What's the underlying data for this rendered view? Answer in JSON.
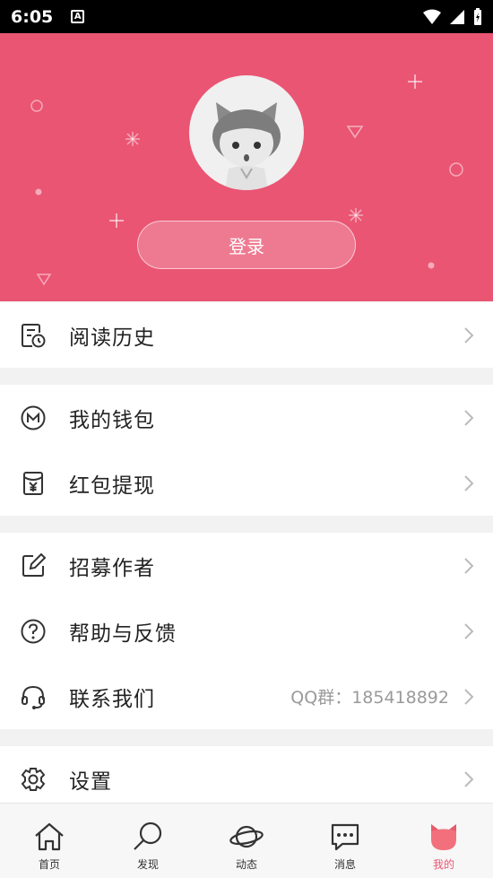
{
  "status_bar": {
    "time": "6:05",
    "badge": "A"
  },
  "header": {
    "login_label": "登录"
  },
  "menu": {
    "reading_history": "阅读历史",
    "my_wallet": "我的钱包",
    "red_packet_withdraw": "红包提现",
    "recruit_authors": "招募作者",
    "help_feedback": "帮助与反馈",
    "contact_us": "联系我们",
    "contact_us_value": "QQ群：185418892",
    "settings": "设置"
  },
  "tabs": [
    {
      "label": "首页",
      "icon": "home-icon"
    },
    {
      "label": "发现",
      "icon": "search-icon"
    },
    {
      "label": "动态",
      "icon": "planet-icon"
    },
    {
      "label": "消息",
      "icon": "message-icon"
    },
    {
      "label": "我的",
      "icon": "cat-icon",
      "active": true
    }
  ],
  "colors": {
    "accent": "#ea5573",
    "text": "#222222",
    "muted": "#9a9a9a"
  }
}
